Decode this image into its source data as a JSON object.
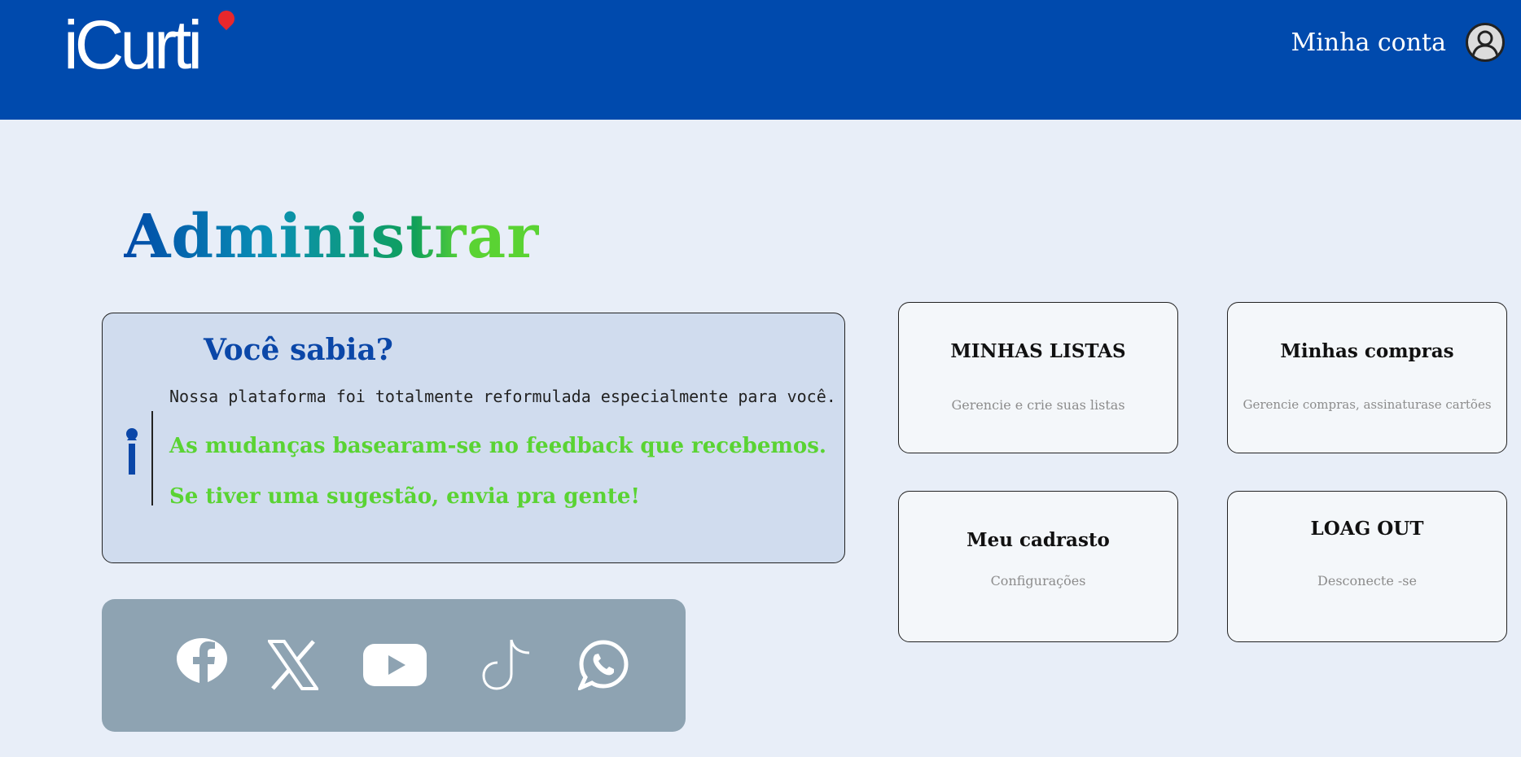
{
  "header": {
    "logo_text": "iCurti",
    "account_label": "Minha conta",
    "background_color": "#004aad"
  },
  "page": {
    "title": "Administrar",
    "title_gradient": [
      "#004aad",
      "#0a8fb0",
      "#0f9e63",
      "#5ad333"
    ]
  },
  "info": {
    "heading": "Você sabia?",
    "line1": "Nossa plataforma foi totalmente reformulada especialmente para você.",
    "line2": "As mudanças basearam-se no feedback que recebemos.",
    "line3": "Se tiver uma sugestão, envia pra gente!"
  },
  "social": {
    "icons": [
      "facebook-icon",
      "x-twitter-icon",
      "youtube-icon",
      "tiktok-icon",
      "whatsapp-icon"
    ]
  },
  "actions": {
    "lists": {
      "title": "MINHAS  LISTAS",
      "subtitle": "Gerencie e crie suas listas"
    },
    "purchases": {
      "title": "Minhas compras",
      "subtitle": "Gerencie compras, assinaturase cartões"
    },
    "profile": {
      "title": "Meu cadrasto",
      "subtitle": "Configurações"
    },
    "logout": {
      "title": "LOAG OUT",
      "subtitle": "Desconecte -se"
    }
  }
}
